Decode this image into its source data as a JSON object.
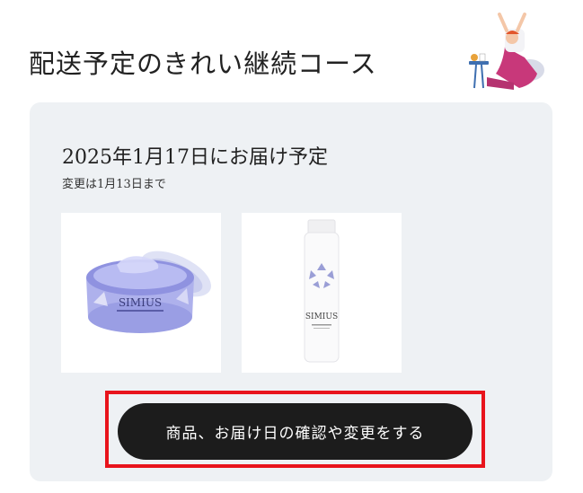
{
  "page": {
    "title": "配送予定のきれい継続コース"
  },
  "delivery": {
    "date_text": "2025年1月17日にお届け予定",
    "change_deadline": "変更は1月13日まで"
  },
  "products": [
    {
      "brand_label": "SIMIUS",
      "icon": "gel-jar-icon"
    },
    {
      "brand_label": "SIMIUS",
      "icon": "lotion-bottle-icon"
    }
  ],
  "actions": {
    "confirm_change_label": "商品、お届け日の確認や変更をする"
  },
  "colors": {
    "card_background": "#eef1f4",
    "button_background": "#1c1c1c",
    "highlight_border": "#e8141c"
  }
}
